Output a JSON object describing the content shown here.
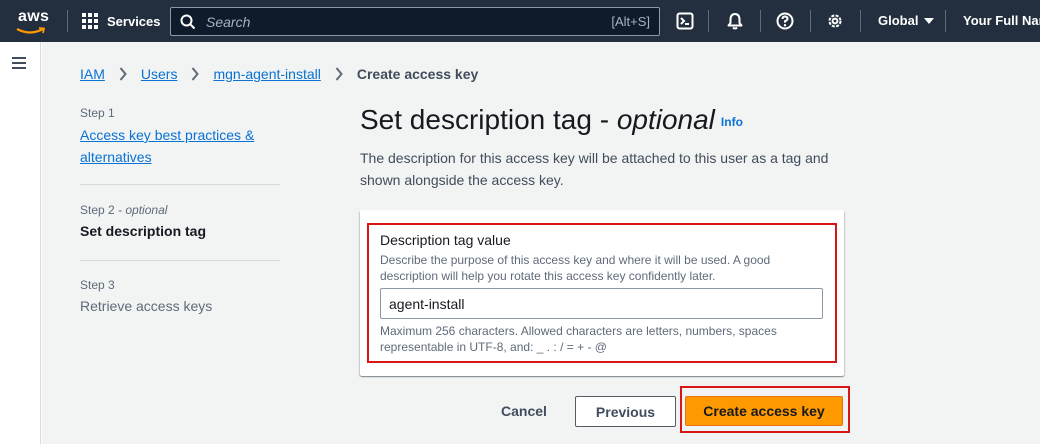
{
  "topnav": {
    "logo_text": "aws",
    "services_label": "Services",
    "search_placeholder": "Search",
    "search_shortcut": "[Alt+S]",
    "icons": [
      "cloudshell-icon",
      "bell-icon",
      "help-icon",
      "gear-icon"
    ],
    "region_label": "Global",
    "user_label": "Your Full Nam"
  },
  "breadcrumb": [
    {
      "label": "IAM"
    },
    {
      "label": "Users"
    },
    {
      "label": "mgn-agent-install"
    },
    {
      "label": "Create access key"
    }
  ],
  "steps": [
    {
      "number": "Step 1",
      "title": "Access key best practices & alternatives"
    },
    {
      "number": "Step 2",
      "optional": "- optional",
      "title": "Set description tag"
    },
    {
      "number": "Step 3",
      "title": "Retrieve access keys"
    }
  ],
  "main": {
    "heading": "Set description tag - ",
    "heading_optional": "optional",
    "info_link": "Info",
    "description": "The description for this access key will be attached to this user as a tag and shown alongside the access key."
  },
  "form": {
    "field_label": "Description tag value",
    "field_description": "Describe the purpose of this access key and where it will be used. A good description will help you rotate this access key confidently later.",
    "field_value": "agent-install",
    "constraint_text": "Maximum 256 characters. Allowed characters are letters, numbers, spaces representable in UTF-8, and: _ . : / = + - @"
  },
  "actions": {
    "cancel_label": "Cancel",
    "previous_label": "Previous",
    "create_label": "Create access key"
  },
  "colors": {
    "nav_bg": "#232f3e",
    "link": "#0972d3",
    "primary_button": "#ff9900",
    "highlight": "#d91515",
    "page_bg": "#f2f3f3"
  }
}
